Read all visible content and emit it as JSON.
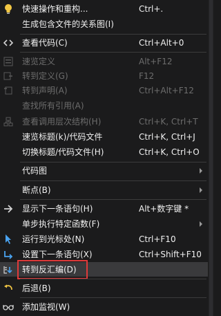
{
  "menu": {
    "items": [
      {
        "label": "快速操作和重构...",
        "shortcut": "Ctrl+.",
        "icon": "lightbulb-icon"
      },
      {
        "label": "生成包含文件的关系图(I)",
        "shortcut": ""
      },
      {
        "label": "查看代码(C)",
        "shortcut": "Ctrl+Alt+0",
        "icon": "code-icon"
      },
      {
        "label": "速览定义",
        "shortcut": "Alt+F12",
        "icon": "peek-definition-icon",
        "disabled": true
      },
      {
        "label": "转到定义(G)",
        "shortcut": "F12",
        "icon": "go-to-definition-icon",
        "disabled": true
      },
      {
        "label": "转到声明(A)",
        "shortcut": "Ctrl+Alt+F12",
        "icon": "go-to-declaration-icon",
        "disabled": true
      },
      {
        "label": "查找所有引用(A)",
        "shortcut": "",
        "disabled": true
      },
      {
        "label": "查看调用层次结构(H)",
        "shortcut": "Ctrl+K, Ctrl+T",
        "icon": "call-hierarchy-icon",
        "disabled": true
      },
      {
        "label": "速览标题(k)/代码文件",
        "shortcut": "Ctrl+K, Ctrl+J"
      },
      {
        "label": "切换标题/代码文件(H)",
        "shortcut": "Ctrl+K, Ctrl+O"
      },
      {
        "label": "代码图",
        "shortcut": "",
        "submenu": true
      },
      {
        "label": "断点(B)",
        "shortcut": "",
        "submenu": true
      },
      {
        "label": "显示下一条语句(H)",
        "shortcut": "Alt+数字键 *",
        "icon": "arrow-right-icon"
      },
      {
        "label": "单步执行特定函数(F)",
        "shortcut": "",
        "submenu": true
      },
      {
        "label": "运行到光标处(N)",
        "shortcut": "Ctrl+F10",
        "icon": "run-to-cursor-icon"
      },
      {
        "label": "设置下一条语句(X)",
        "shortcut": "Ctrl+Shift+F10",
        "icon": "set-next-statement-icon"
      },
      {
        "label": "转到反汇编(D)",
        "shortcut": "",
        "icon": "disassembly-icon",
        "highlighted": true
      },
      {
        "label": "后退(B)",
        "shortcut": "",
        "icon": "back-icon"
      },
      {
        "label": "添加监视(W)",
        "shortcut": "",
        "icon": "glasses-icon"
      }
    ]
  },
  "colors": {
    "accent": "#e03a3a",
    "hover": "#3a3a3c",
    "background": "#1b1b1c"
  }
}
